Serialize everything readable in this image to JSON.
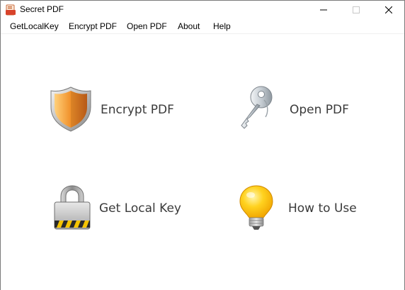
{
  "window": {
    "title": "Secret PDF",
    "app_icon": "pdf-document-icon"
  },
  "menu": {
    "items": [
      {
        "label": "GetLocalKey"
      },
      {
        "label": "Encrypt PDF"
      },
      {
        "label": "Open PDF"
      },
      {
        "label": "About"
      },
      {
        "label": "Help"
      }
    ]
  },
  "actions": {
    "encrypt": {
      "label": "Encrypt PDF",
      "icon": "shield-icon"
    },
    "open": {
      "label": "Open PDF",
      "icon": "key-icon"
    },
    "local_key": {
      "label": "Get Local Key",
      "icon": "padlock-icon"
    },
    "how_to": {
      "label": "How to Use",
      "icon": "lightbulb-icon"
    }
  },
  "colors": {
    "shield_orange": "#f0902a",
    "bulb_yellow": "#ffc21a",
    "lock_gray": "#b8b8b8",
    "label_text": "#3a3a3a"
  }
}
